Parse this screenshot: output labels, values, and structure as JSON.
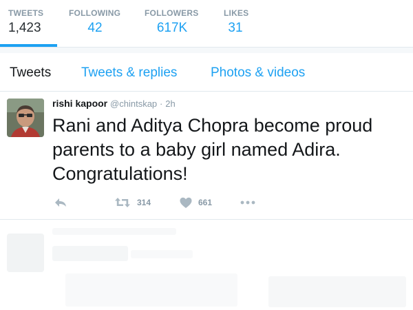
{
  "profile_nav": {
    "tweets": {
      "label": "TWEETS",
      "value": "1,423"
    },
    "following": {
      "label": "FOLLOWING",
      "value": "42"
    },
    "followers": {
      "label": "FOLLOWERS",
      "value": "617K"
    },
    "likes": {
      "label": "LIKES",
      "value": "31"
    },
    "active": "tweets"
  },
  "tabs": [
    {
      "label": "Tweets",
      "active": true
    },
    {
      "label": "Tweets & replies",
      "active": false
    },
    {
      "label": "Photos & videos",
      "active": false
    }
  ],
  "tweet": {
    "author": "rishi kapoor",
    "handle": "@chintskap",
    "separator": "·",
    "time": "2h",
    "text": "Rani and Aditya Chopra become proud parents to a baby girl named Adira. Congratulations!",
    "actions": {
      "reply": {
        "icon": "reply-icon"
      },
      "retweet": {
        "icon": "retweet-icon",
        "count": "314"
      },
      "like": {
        "icon": "heart-icon",
        "count": "661"
      },
      "more": {
        "icon": "more-dots-icon"
      }
    }
  },
  "colors": {
    "accent": "#1da1f2",
    "text": "#14171a",
    "muted": "#8899a6",
    "border": "#e1e8ed"
  }
}
